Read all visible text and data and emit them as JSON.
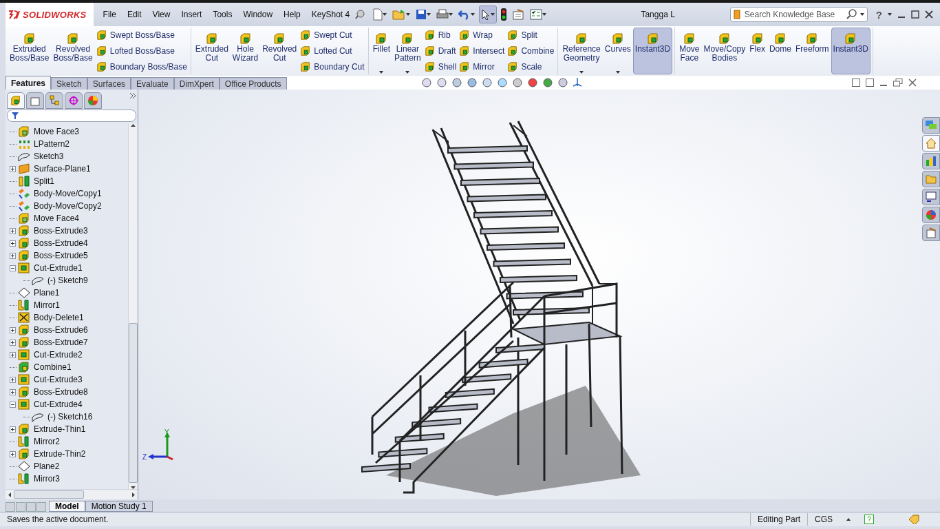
{
  "app": {
    "brand": "SOLIDWORKS",
    "menu": [
      "File",
      "Edit",
      "View",
      "Insert",
      "Tools",
      "Window",
      "Help",
      "KeyShot 4"
    ],
    "document_title": "Tangga L",
    "search": {
      "placeholder": "Search Knowledge Base"
    },
    "help": "?"
  },
  "ribbon": {
    "groups": [
      {
        "items": [
          {
            "kind": "large",
            "label": "Extruded\nBoss/Base",
            "selected": false
          },
          {
            "kind": "large",
            "label": "Revolved\nBoss/Base",
            "selected": false
          },
          {
            "kind": "stack",
            "labels": [
              "Swept Boss/Base",
              "Lofted Boss/Base",
              "Boundary Boss/Base"
            ]
          }
        ]
      },
      {
        "items": [
          {
            "kind": "large",
            "label": "Extruded\nCut",
            "selected": false
          },
          {
            "kind": "large",
            "label": "Hole\nWizard",
            "selected": false
          },
          {
            "kind": "large",
            "label": "Revolved\nCut",
            "selected": false
          },
          {
            "kind": "stack",
            "labels": [
              "Swept Cut",
              "Lofted Cut",
              "Boundary Cut"
            ]
          }
        ]
      },
      {
        "items": [
          {
            "kind": "menu",
            "label": "Fillet",
            "selected": false
          },
          {
            "kind": "menu",
            "label": "Linear\nPattern",
            "selected": false
          },
          {
            "kind": "stack",
            "labels": [
              "Rib",
              "Draft",
              "Shell"
            ]
          },
          {
            "kind": "stack",
            "labels": [
              "Wrap",
              "Intersect",
              "Mirror"
            ]
          },
          {
            "kind": "stack",
            "labels": [
              "Split",
              "Combine",
              "Scale"
            ]
          }
        ]
      },
      {
        "items": [
          {
            "kind": "menu",
            "label": "Reference\nGeometry",
            "selected": false
          },
          {
            "kind": "menu",
            "label": "Curves",
            "selected": false
          },
          {
            "kind": "large",
            "label": "Instant3D",
            "selected": true
          }
        ]
      },
      {
        "items": [
          {
            "kind": "large",
            "label": "Move\nFace",
            "selected": false
          },
          {
            "kind": "large",
            "label": "Move/Copy\nBodies",
            "selected": false
          },
          {
            "kind": "large",
            "label": "Flex",
            "selected": false
          },
          {
            "kind": "large",
            "label": "Dome",
            "selected": false
          },
          {
            "kind": "large",
            "label": "Freeform",
            "selected": false
          },
          {
            "kind": "large",
            "label": "Instant3D",
            "selected": true
          }
        ]
      }
    ]
  },
  "command_tabs": [
    {
      "label": "Features",
      "selected": true
    },
    {
      "label": "Sketch",
      "selected": false
    },
    {
      "label": "Surfaces",
      "selected": false
    },
    {
      "label": "Evaluate",
      "selected": false
    },
    {
      "label": "DimXpert",
      "selected": false
    },
    {
      "label": "Office Products",
      "selected": false
    }
  ],
  "feature_tree": [
    {
      "name": "Move Face3",
      "kind": "move-face"
    },
    {
      "name": "LPattern2",
      "kind": "pattern"
    },
    {
      "name": "Sketch3",
      "kind": "sketch"
    },
    {
      "name": "Surface-Plane1",
      "kind": "surface",
      "expanded": false
    },
    {
      "name": "Split1",
      "kind": "split"
    },
    {
      "name": "Body-Move/Copy1",
      "kind": "body-move"
    },
    {
      "name": "Body-Move/Copy2",
      "kind": "body-move"
    },
    {
      "name": "Move Face4",
      "kind": "move-face"
    },
    {
      "name": "Boss-Extrude3",
      "kind": "boss",
      "expanded": false
    },
    {
      "name": "Boss-Extrude4",
      "kind": "boss",
      "expanded": false
    },
    {
      "name": "Boss-Extrude5",
      "kind": "boss",
      "expanded": false
    },
    {
      "name": "Cut-Extrude1",
      "kind": "cut",
      "expanded": true,
      "children": [
        {
          "name": "(-) Sketch9",
          "kind": "sketch"
        }
      ]
    },
    {
      "name": "Plane1",
      "kind": "plane"
    },
    {
      "name": "Mirror1",
      "kind": "mirror"
    },
    {
      "name": "Body-Delete1",
      "kind": "delete"
    },
    {
      "name": "Boss-Extrude6",
      "kind": "boss",
      "expanded": false
    },
    {
      "name": "Boss-Extrude7",
      "kind": "boss",
      "expanded": false
    },
    {
      "name": "Cut-Extrude2",
      "kind": "cut",
      "expanded": false
    },
    {
      "name": "Combine1",
      "kind": "combine"
    },
    {
      "name": "Cut-Extrude3",
      "kind": "cut",
      "expanded": false
    },
    {
      "name": "Boss-Extrude8",
      "kind": "boss",
      "expanded": false
    },
    {
      "name": "Cut-Extrude4",
      "kind": "cut",
      "expanded": true,
      "children": [
        {
          "name": "(-) Sketch16",
          "kind": "sketch"
        }
      ]
    },
    {
      "name": "Extrude-Thin1",
      "kind": "boss",
      "expanded": false
    },
    {
      "name": "Mirror2",
      "kind": "mirror"
    },
    {
      "name": "Extrude-Thin2",
      "kind": "boss",
      "expanded": false
    },
    {
      "name": "Plane2",
      "kind": "plane"
    },
    {
      "name": "Mirror3",
      "kind": "mirror"
    }
  ],
  "triad": {
    "y_label": "Y",
    "z_label": "Z"
  },
  "bottom_tabs": [
    {
      "label": "Model",
      "selected": true
    },
    {
      "label": "Motion Study 1",
      "selected": false
    }
  ],
  "status_bar": {
    "message": "Saves the active document.",
    "mode": "Editing Part",
    "units": "CGS"
  }
}
